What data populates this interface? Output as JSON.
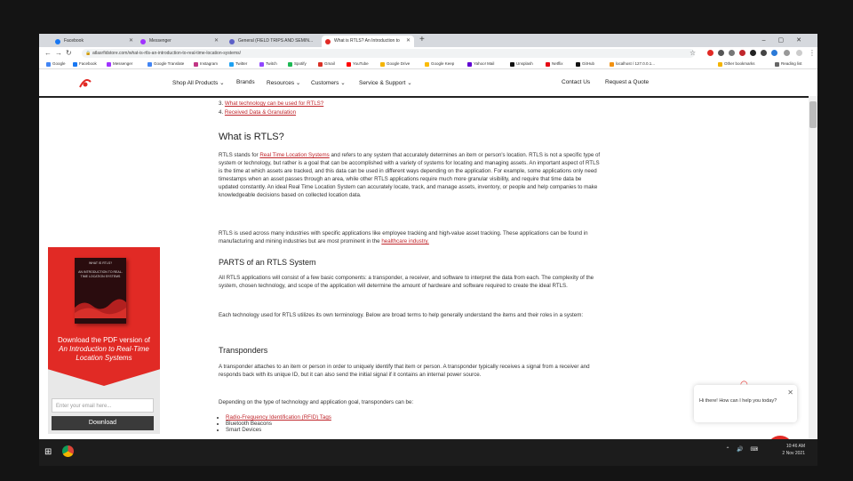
{
  "browser": {
    "tabs": [
      {
        "label": "Facebook",
        "color": "#1877f2"
      },
      {
        "label": "Messenger",
        "color": "#a033ff"
      },
      {
        "label": "General (FIELD TRIPS AND SEMIN...",
        "color": "#5b5fc7"
      },
      {
        "label": "What is RTLS? An Introduction to",
        "color": "#e12a25",
        "active": true
      }
    ],
    "url": "atlasrfidstore.com/what-is-rtls-an-introduction-to-real-time-location-systems/",
    "bookmarks": [
      {
        "label": "Google",
        "color": "#4285f4"
      },
      {
        "label": "Facebook",
        "color": "#1877f2"
      },
      {
        "label": "Messenger",
        "color": "#a033ff"
      },
      {
        "label": "Google Translate",
        "color": "#4285f4"
      },
      {
        "label": "Instagram",
        "color": "#c13584"
      },
      {
        "label": "Twitter",
        "color": "#1da1f2"
      },
      {
        "label": "Twitch",
        "color": "#9146ff"
      },
      {
        "label": "Spotify",
        "color": "#1db954"
      },
      {
        "label": "Gmail",
        "color": "#d93025"
      },
      {
        "label": "YouTube",
        "color": "#ff0000"
      },
      {
        "label": "Google Drive",
        "color": "#f4b400"
      },
      {
        "label": "Google Keep",
        "color": "#fbbc04"
      },
      {
        "label": "Yahoo! Mail",
        "color": "#6001d2"
      },
      {
        "label": "Unsplash",
        "color": "#111111"
      },
      {
        "label": "Netflix",
        "color": "#e50914"
      },
      {
        "label": "GitHub",
        "color": "#111111"
      },
      {
        "label": "localhost / 127.0.0.1...",
        "color": "#f29111"
      },
      {
        "label": "Other bookmarks",
        "color": "#f4b400"
      },
      {
        "label": "Reading list",
        "color": "#666666"
      }
    ]
  },
  "site": {
    "nav": [
      {
        "label": "Shop All Products"
      },
      {
        "label": "Brands"
      },
      {
        "label": "Resources"
      },
      {
        "label": "Customers"
      },
      {
        "label": "Service & Support"
      }
    ],
    "contact": "Contact Us",
    "quote": "Request a Quote",
    "accent": "#e12a25"
  },
  "sidebar": {
    "book_title": "AN INTRODUCTION TO REAL-TIME LOCATION SYSTEMS",
    "book_label": "WHAT IS RTLS?",
    "promo_line1": "Download the PDF version of ",
    "promo_em": "An Introduction to Real-Time Location Systems",
    "email_placeholder": "Enter your email here...",
    "download": "Download"
  },
  "article": {
    "toc": [
      {
        "num": "3.",
        "label": "What technology can be used for RTLS?"
      },
      {
        "num": "4.",
        "label": "Received Data & Granulation"
      }
    ],
    "h_what": "What is RTLS?",
    "p1_pre": "RTLS stands for ",
    "p1_link": "Real Time Location Systems",
    "p1_post": " and refers to any system that accurately determines an item or person's location. RTLS is not a specific type of system or technology, but rather is a goal that can be accomplished with a variety of systems for locating and managing assets. An important aspect of RTLS is the time at which assets are tracked, and this data can be used in different ways depending on the application. For example, some applications only need timestamps when an asset passes through an area, while other RTLS applications require much more granular visibility, and require that time data be updated constantly. An ideal Real Time Location System can accurately locate, track, and manage assets, inventory, or people and help companies to make knowledgeable decisions based on collected location data.",
    "p2_pre": "RTLS is used across many industries with specific applications like employee tracking and high-value asset tracking. These applications can be found in manufacturing and mining industries but are most prominent in the ",
    "p2_link": "healthcare industry.",
    "h_parts": "PARTS of an RTLS System",
    "p3": "All RTLS applications will consist of a few basic components: a transponder, a receiver, and software to interpret the data from each. The complexity of the system, chosen technology, and scope of the application will determine the amount of hardware and software required to create the ideal RTLS.",
    "p4": "Each technology used for RTLS utilizes its own terminology. Below are broad terms to help generally understand the items and their roles in a system:",
    "h_trans": "Transponders",
    "p5": "A transponder attaches to an item or person in order to uniquely identify that item or person. A transponder typically receives a signal from a receiver and responds back with its unique ID, but it can also send the initial signal if it contains an internal power source.",
    "p6": "Depending on the type of technology and application goal, transponders can be:",
    "list": [
      {
        "label": "Radio-Frequency Identification (RFID) Tags",
        "link": true
      },
      {
        "label": "Bluetooth Beacons",
        "link": false
      },
      {
        "label": "Smart Devices",
        "link": false
      }
    ]
  },
  "chat": {
    "message": "Hi there! How can I help you today?"
  },
  "taskbar": {
    "time": "10:46 AM",
    "date": "2 Nov 2021"
  }
}
